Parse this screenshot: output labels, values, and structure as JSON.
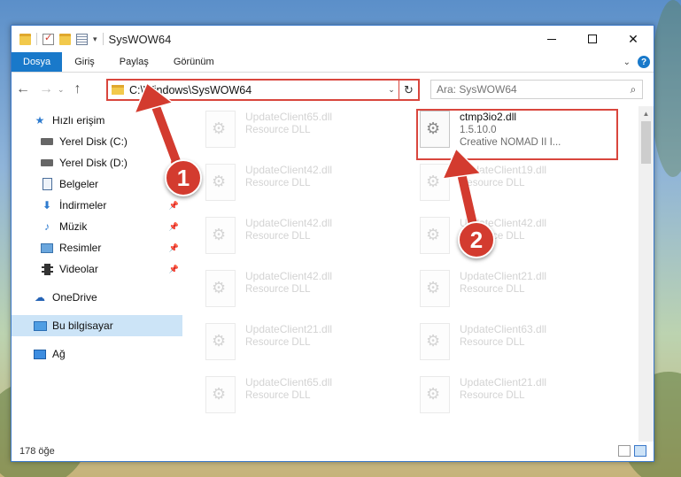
{
  "window": {
    "title": "SysWOW64"
  },
  "ribbon": {
    "tabs": [
      "Dosya",
      "Giriş",
      "Paylaş",
      "Görünüm"
    ]
  },
  "nav": {
    "address": "C:\\Windows\\SysWOW64",
    "search_placeholder": "Ara: SysWOW64"
  },
  "sidebar": {
    "items": [
      {
        "label": "Hızlı erişim",
        "icon": "star-icon"
      },
      {
        "label": "Yerel Disk (C:)",
        "icon": "drive-icon"
      },
      {
        "label": "Yerel Disk (D:)",
        "icon": "drive-icon"
      },
      {
        "label": "Belgeler",
        "icon": "document-icon"
      },
      {
        "label": "İndirmeler",
        "icon": "download-icon"
      },
      {
        "label": "Müzik",
        "icon": "music-icon"
      },
      {
        "label": "Resimler",
        "icon": "pictures-icon"
      },
      {
        "label": "Videolar",
        "icon": "video-icon"
      },
      {
        "label": "OneDrive",
        "icon": "cloud-icon"
      },
      {
        "label": "Bu bilgisayar",
        "icon": "computer-icon"
      },
      {
        "label": "Ağ",
        "icon": "network-icon"
      }
    ]
  },
  "files": {
    "highlighted": {
      "name": "ctmp3io2.dll",
      "version": "1.5.10.0",
      "description": "Creative NOMAD II I..."
    },
    "left_column": [
      {
        "name": "UpdateClient65.dll",
        "type": "Resource DLL"
      },
      {
        "name": "UpdateClient42.dll",
        "type": "Resource DLL"
      },
      {
        "name": "UpdateClient42.dll",
        "type": "Resource DLL"
      },
      {
        "name": "UpdateClient42.dll",
        "type": "Resource DLL"
      },
      {
        "name": "UpdateClient21.dll",
        "type": "Resource DLL"
      },
      {
        "name": "UpdateClient65.dll",
        "type": "Resource DLL"
      }
    ],
    "right_column": [
      {
        "name": "UpdateClient19.dll",
        "type": "Resource DLL"
      },
      {
        "name": "UpdateClient42.dll",
        "type": "Resource DLL"
      },
      {
        "name": "UpdateClient21.dll",
        "type": "Resource DLL"
      },
      {
        "name": "UpdateClient63.dll",
        "type": "Resource DLL"
      },
      {
        "name": "UpdateClient21.dll",
        "type": "Resource DLL"
      }
    ]
  },
  "status": {
    "count": "178 öğe"
  },
  "annotations": {
    "one": "1",
    "two": "2",
    "color": "#d33b2f"
  }
}
